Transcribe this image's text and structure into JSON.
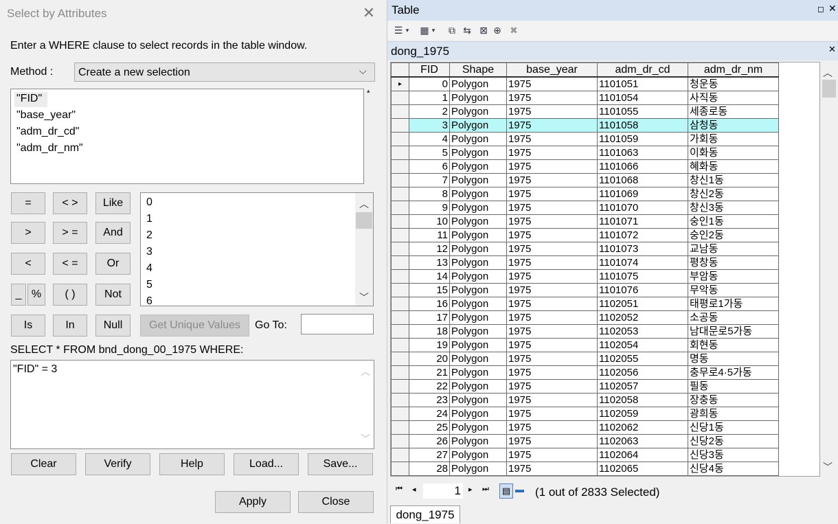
{
  "dialog": {
    "title": "Select by Attributes",
    "instruction": "Enter a WHERE clause to select records in the table window.",
    "method_label": "Method :",
    "method_value": "Create a new selection",
    "fields": [
      "\"FID\"",
      "\"base_year\"",
      "\"adm_dr_cd\"",
      "\"adm_dr_nm\""
    ],
    "operators": {
      "eq": "=",
      "ne": "< >",
      "like": "Like",
      "gt": ">",
      "ge": "> =",
      "and": "And",
      "lt": "<",
      "le": "< =",
      "or": "Or",
      "underscore": "_",
      "percent": "%",
      "parens": "( )",
      "not": "Not",
      "is": "Is",
      "in": "In",
      "null": "Null"
    },
    "unique_values": [
      "0",
      "1",
      "2",
      "3",
      "4",
      "5",
      "6"
    ],
    "get_unique_values_label": "Get Unique Values",
    "goto_label": "Go To:",
    "goto_value": "",
    "sql_prefix": "SELECT * FROM bnd_dong_00_1975 WHERE:",
    "expression": "\"FID\" = 3",
    "buttons": {
      "clear": "Clear",
      "verify": "Verify",
      "help": "Help",
      "load": "Load...",
      "save": "Save...",
      "apply": "Apply",
      "close": "Close"
    }
  },
  "table_window": {
    "title": "Table",
    "tab_name": "dong_1975",
    "columns": [
      "FID",
      "Shape",
      "base_year",
      "adm_dr_cd",
      "adm_dr_nm"
    ],
    "selected_fid": 3,
    "rows": [
      [
        "0",
        "Polygon",
        "1975",
        "1101051",
        "청운동"
      ],
      [
        "1",
        "Polygon",
        "1975",
        "1101054",
        "사직동"
      ],
      [
        "2",
        "Polygon",
        "1975",
        "1101055",
        "세종로동"
      ],
      [
        "3",
        "Polygon",
        "1975",
        "1101058",
        "삼청동"
      ],
      [
        "4",
        "Polygon",
        "1975",
        "1101059",
        "가회동"
      ],
      [
        "5",
        "Polygon",
        "1975",
        "1101063",
        "이화동"
      ],
      [
        "6",
        "Polygon",
        "1975",
        "1101066",
        "혜화동"
      ],
      [
        "7",
        "Polygon",
        "1975",
        "1101068",
        "창신1동"
      ],
      [
        "8",
        "Polygon",
        "1975",
        "1101069",
        "창신2동"
      ],
      [
        "9",
        "Polygon",
        "1975",
        "1101070",
        "창신3동"
      ],
      [
        "10",
        "Polygon",
        "1975",
        "1101071",
        "숭인1동"
      ],
      [
        "11",
        "Polygon",
        "1975",
        "1101072",
        "숭인2동"
      ],
      [
        "12",
        "Polygon",
        "1975",
        "1101073",
        "교남동"
      ],
      [
        "13",
        "Polygon",
        "1975",
        "1101074",
        "평창동"
      ],
      [
        "14",
        "Polygon",
        "1975",
        "1101075",
        "부암동"
      ],
      [
        "15",
        "Polygon",
        "1975",
        "1101076",
        "무악동"
      ],
      [
        "16",
        "Polygon",
        "1975",
        "1102051",
        "태평로1가동"
      ],
      [
        "17",
        "Polygon",
        "1975",
        "1102052",
        "소공동"
      ],
      [
        "18",
        "Polygon",
        "1975",
        "1102053",
        "남대문로5가동"
      ],
      [
        "19",
        "Polygon",
        "1975",
        "1102054",
        "회현동"
      ],
      [
        "20",
        "Polygon",
        "1975",
        "1102055",
        "명동"
      ],
      [
        "21",
        "Polygon",
        "1975",
        "1102056",
        "충무로4·5가동"
      ],
      [
        "22",
        "Polygon",
        "1975",
        "1102057",
        "필동"
      ],
      [
        "23",
        "Polygon",
        "1975",
        "1102058",
        "장충동"
      ],
      [
        "24",
        "Polygon",
        "1975",
        "1102059",
        "광희동"
      ],
      [
        "25",
        "Polygon",
        "1975",
        "1102062",
        "신당1동"
      ],
      [
        "26",
        "Polygon",
        "1975",
        "1102063",
        "신당2동"
      ],
      [
        "27",
        "Polygon",
        "1975",
        "1102064",
        "신당3동"
      ],
      [
        "28",
        "Polygon",
        "1975",
        "1102065",
        "신당4동"
      ]
    ],
    "current_record": "1",
    "selection_status": "(1 out of 2833 Selected)"
  }
}
